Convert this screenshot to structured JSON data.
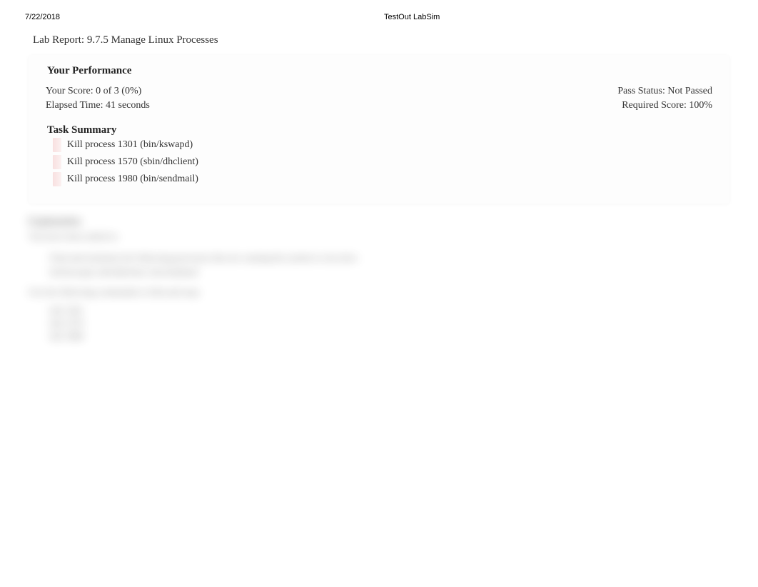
{
  "header": {
    "date": "7/22/2018",
    "app_title": "TestOut LabSim"
  },
  "report": {
    "title": "Lab Report: 9.7.5 Manage Linux Processes",
    "performance_title": "Your Performance",
    "score_line": "Your Score: 0 of 3 (0%)",
    "pass_status": "Pass Status: Not Passed",
    "elapsed_time": "Elapsed Time: 41 seconds",
    "required_score": "Required Score: 100%",
    "task_summary_title": "Task Summary",
    "tasks": [
      "Kill process 1301 (bin/kswapd)",
      "Kill process 1570 (sbin/dhclient)",
      "Kill process 1980 (bin/sendmail)"
    ]
  },
  "blurred": {
    "heading": "Explanation",
    "subline": "You have been asked to:",
    "block_lines": [
      "Find and terminate the following processes that are causing the system to run slow:",
      "bin/kswapd, sbin/dhclient, bin/sendmail"
    ],
    "para": "Use the following commands to find and stop:",
    "cmds": [
      "kill 1301",
      "kill 1570",
      "kill 1980"
    ]
  }
}
